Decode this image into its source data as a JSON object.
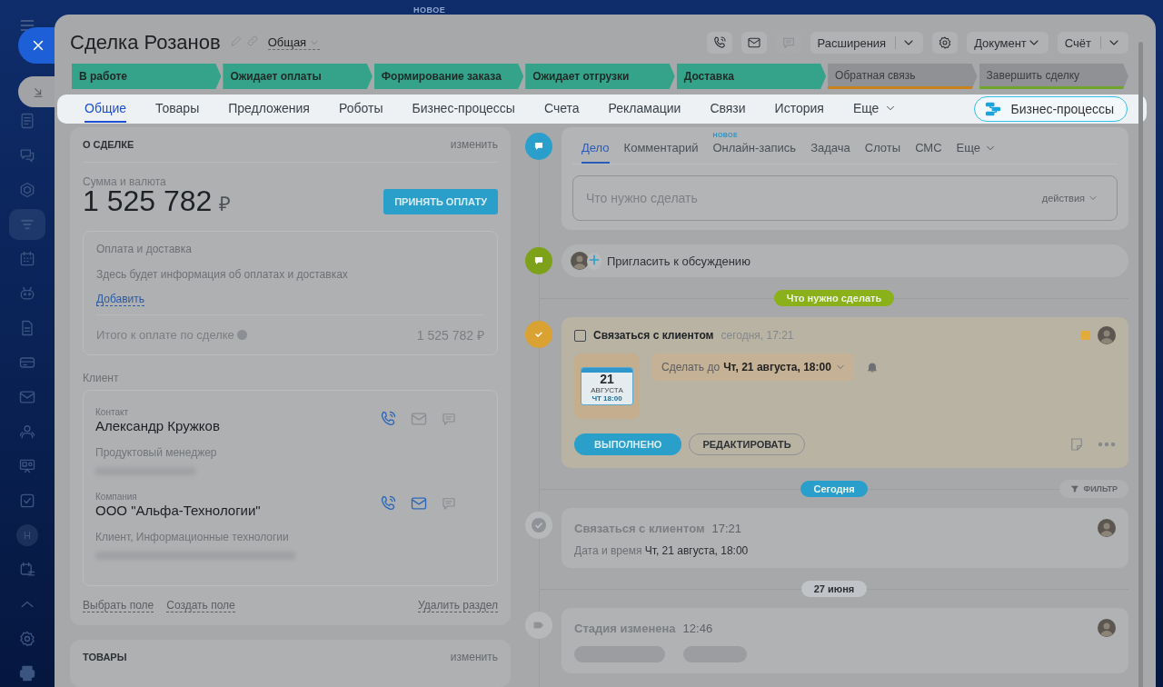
{
  "background": {
    "badge": "НОВОЕ"
  },
  "sidebar": {
    "items": [
      {
        "selected": false
      },
      {
        "selected": false
      },
      {
        "selected": false
      },
      {
        "selected": true
      },
      {
        "selected": false
      },
      {
        "selected": false
      },
      {
        "selected": false
      },
      {
        "selected": false
      },
      {
        "selected": false
      },
      {
        "selected": false
      },
      {
        "selected": false
      },
      {
        "selected": false
      },
      {
        "selected": false,
        "letter": "H"
      },
      {
        "selected": false
      },
      {
        "selected": false
      },
      {
        "selected": false
      },
      {
        "selected": false
      }
    ]
  },
  "header": {
    "title": "Сделка Розанов",
    "category": "Общая",
    "actions": [
      {
        "kind": "icon",
        "disabled": false
      },
      {
        "kind": "icon",
        "disabled": false
      },
      {
        "kind": "icon",
        "disabled": true
      },
      {
        "kind": "split",
        "label": "Расширения"
      },
      {
        "kind": "icon",
        "disabled": false
      },
      {
        "kind": "dropdown",
        "label": "Документ"
      },
      {
        "kind": "split",
        "label": "Счёт"
      }
    ]
  },
  "stages": [
    {
      "label": "В работе",
      "passed": true,
      "color": "#34a38a"
    },
    {
      "label": "Ожидает оплаты",
      "passed": true,
      "color": "#34a38a"
    },
    {
      "label": "Формирование заказа",
      "passed": true,
      "color": "#34a38a"
    },
    {
      "label": "Ожидает отгрузки",
      "passed": true,
      "color": "#34a38a"
    },
    {
      "label": "Доставка",
      "passed": true,
      "color": "#34a38a"
    },
    {
      "label": "Обратная связь",
      "passed": false,
      "color": "#c9811c"
    },
    {
      "label": "Завершить сделку",
      "passed": false,
      "color": "#6fa52a"
    }
  ],
  "tabs": [
    {
      "label": "Общие",
      "selected": true
    },
    {
      "label": "Товары",
      "selected": false
    },
    {
      "label": "Предложения",
      "selected": false
    },
    {
      "label": "Роботы",
      "selected": false
    },
    {
      "label": "Бизнес-процессы",
      "selected": false
    },
    {
      "label": "Счета",
      "selected": false
    },
    {
      "label": "Рекламации",
      "selected": false
    },
    {
      "label": "Связи",
      "selected": false
    },
    {
      "label": "История",
      "selected": false
    },
    {
      "label": "Еще",
      "selected": false,
      "kind": "more"
    }
  ],
  "process_button": "Бизнес-процессы",
  "about": {
    "title": "О СДЕЛКЕ",
    "edit": "изменить",
    "amount_label": "Сумма и валюта",
    "amount": "1 525 782",
    "currency": "₽",
    "pay_button": "ПРИНЯТЬ ОПЛАТУ",
    "payment": {
      "title": "Оплата и доставка",
      "note": "Здесь будет информация об оплатах и доставках",
      "add_link": "Добавить",
      "total_label": "Итого к оплате по сделке",
      "total": "1 525 782 ₽"
    },
    "client_label": "Клиент",
    "clients": [
      {
        "type_label": "Контакт",
        "name": "Александр Кружков",
        "detail": "Продуктовый менеджер",
        "mail_active": false
      },
      {
        "type_label": "Компания",
        "name": "ООО \"Альфа-Технологии\"",
        "detail": "Клиент, Информационные технологии",
        "mail_active": true
      }
    ],
    "footer_links": [
      "Выбрать поле",
      "Создать поле"
    ],
    "delete_link": "Удалить раздел"
  },
  "products": {
    "title": "ТОВАРЫ",
    "edit": "изменить"
  },
  "editor": {
    "tabs": [
      {
        "label": "Дело",
        "selected": true
      },
      {
        "label": "Комментарий",
        "selected": false
      },
      {
        "label": "Онлайн-запись",
        "selected": false,
        "badge": "НОВОЕ"
      },
      {
        "label": "Задача",
        "selected": false
      },
      {
        "label": "Слоты",
        "selected": false
      },
      {
        "label": "СМС",
        "selected": false
      },
      {
        "label": "Еще",
        "selected": false,
        "kind": "more"
      }
    ],
    "placeholder": "Что нужно сделать",
    "actions": "действия"
  },
  "invite": "Пригласить к обсуждению",
  "timeline": [
    {
      "kind": "divider",
      "label": "Что нужно сделать",
      "color": "#8ab01a"
    },
    {
      "kind": "task",
      "checked": false,
      "title": "Связаться с клиентом",
      "time": "сегодня, 17:21",
      "color": "#e2ac3a",
      "calendar": {
        "day": "21",
        "month": "АВГУСТА",
        "time": "ЧТ 18:00"
      },
      "deadline": "Сделать до **Чт, 21 августа, 18:00**",
      "done_button": "ВЫПОЛНЕНО",
      "edit_button": "РЕДАКТИРОВАТЬ"
    },
    {
      "kind": "divider",
      "label": "Сегодня",
      "color": "#2a9fcb",
      "filter": "ФИЛЬТР"
    },
    {
      "kind": "entry",
      "title": "Связаться с клиентом",
      "time": "17:21",
      "detail": "Дата и время **Чт, 21 августа, 18:00**"
    },
    {
      "kind": "divider",
      "label": "27 июня",
      "color": "#c0c4c8"
    },
    {
      "kind": "entry",
      "title": "Стадия изменена",
      "time": "12:46"
    }
  ]
}
